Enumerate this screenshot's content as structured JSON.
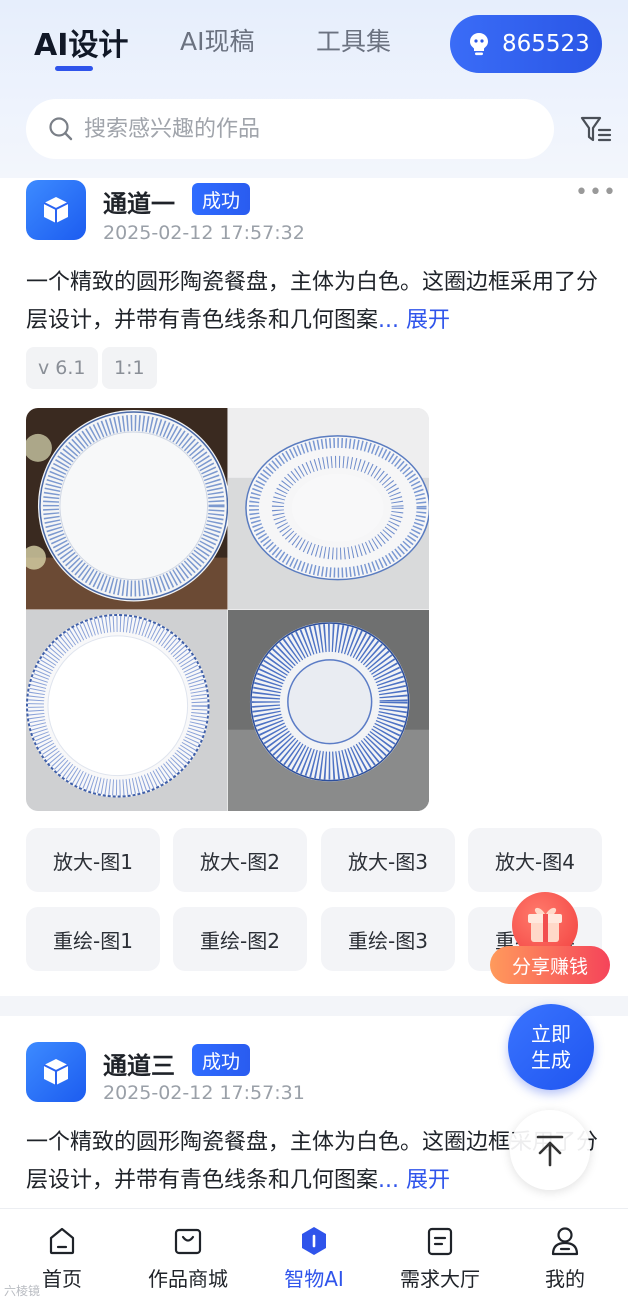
{
  "header": {
    "tabs": [
      {
        "label": "AI设计",
        "active": true
      },
      {
        "label": "AI现稿",
        "active": false
      },
      {
        "label": "工具集",
        "active": false
      }
    ],
    "points": "865523",
    "search_placeholder": "搜索感兴趣的作品"
  },
  "cards": [
    {
      "channel": "通道一",
      "status": "成功",
      "time": "2025-02-12 17:57:32",
      "description": "一个精致的圆形陶瓷餐盘，主体为白色。这圈边框采用了分层设计，并带有青色线条和几何图案",
      "expand": "... 展开",
      "tags": [
        "v 6.1",
        "1:1"
      ],
      "actions_row1": [
        "放大-图1",
        "放大-图2",
        "放大-图3",
        "放大-图4"
      ],
      "actions_row2": [
        "重绘-图1",
        "重绘-图2",
        "重绘-图3",
        "重绘-图4"
      ]
    },
    {
      "channel": "通道三",
      "status": "成功",
      "time": "2025-02-12 17:57:31",
      "description": "一个精致的圆形陶瓷餐盘，主体为白色。这圈边框采用了分层设计，并带有青色线条和几何图案",
      "expand": "... 展开"
    }
  ],
  "floating": {
    "share": "分享赚钱",
    "generate_line1": "立即",
    "generate_line2": "生成"
  },
  "nav": [
    {
      "label": "首页",
      "icon": "home-icon",
      "active": false
    },
    {
      "label": "作品商城",
      "icon": "shop-bag-icon",
      "active": false
    },
    {
      "label": "智物AI",
      "icon": "ai-hexagon-icon",
      "active": true
    },
    {
      "label": "需求大厅",
      "icon": "document-icon",
      "active": false
    },
    {
      "label": "我的",
      "icon": "user-icon",
      "active": false
    }
  ],
  "watermark": "六棱镜",
  "colors": {
    "accent": "#2f54eb",
    "badge": "#2f6cff",
    "share_gradient": "#f5445a"
  }
}
